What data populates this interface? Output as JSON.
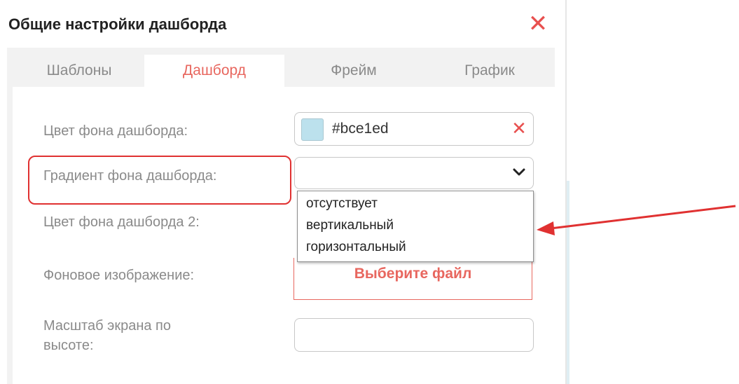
{
  "dialog": {
    "title": "Общие настройки дашборда",
    "close_label": "✕"
  },
  "tabs": [
    {
      "label": "Шаблоны",
      "active": false
    },
    {
      "label": "Дашборд",
      "active": true
    },
    {
      "label": "Фрейм",
      "active": false
    },
    {
      "label": "График",
      "active": false
    }
  ],
  "form": {
    "bg_color": {
      "label": "Цвет фона дашборда:",
      "value": "#bce1ed",
      "swatch_color": "#bce1ed",
      "clear_label": "✕"
    },
    "gradient": {
      "label": "Градиент фона дашборда:",
      "value": "",
      "options": [
        "отсутствует",
        "вертикальный",
        "горизонтальный"
      ]
    },
    "bg_color2": {
      "label": "Цвет фона дашборда 2:"
    },
    "bg_image": {
      "label": "Фоновое изображение:",
      "button_label": "Выберите файл"
    },
    "screen_scale": {
      "label_line1": "Масштаб экрана по",
      "label_line2": "высоте:",
      "value": ""
    }
  },
  "colors": {
    "accent": "#e8675f",
    "close": "#e8504f",
    "annotation": "#e03131"
  }
}
